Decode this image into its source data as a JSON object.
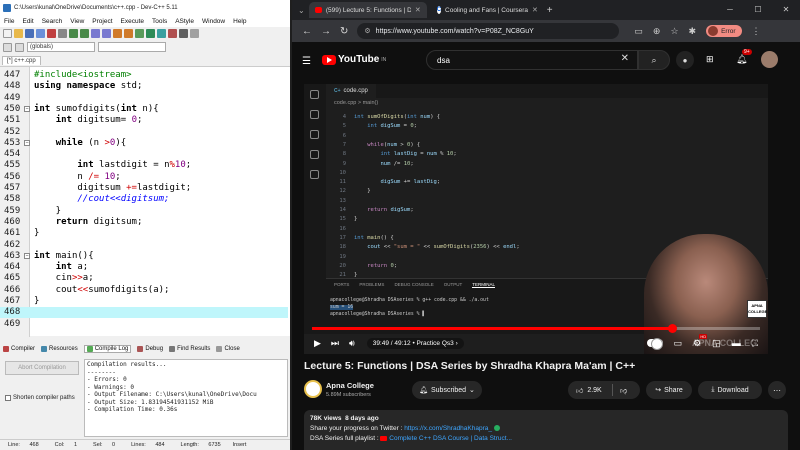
{
  "devcpp": {
    "window_title": "C:\\Users\\kunal\\OneDrive\\Documents\\c++.cpp - Dev-C++ 5.11",
    "menu": [
      "File",
      "Edit",
      "Search",
      "View",
      "Project",
      "Execute",
      "Tools",
      "AStyle",
      "Window",
      "Help"
    ],
    "scope_combo": "(globals)",
    "file_tab": "[*] c++.cpp",
    "code_lines": [
      {
        "n": "447",
        "text": "#include<iostream>"
      },
      {
        "n": "448",
        "text": "using namespace std;"
      },
      {
        "n": "449",
        "text": ""
      },
      {
        "n": "450",
        "text": "int sumofdigits(int n){"
      },
      {
        "n": "451",
        "text": "    int digitsum= 0;"
      },
      {
        "n": "452",
        "text": ""
      },
      {
        "n": "453",
        "text": "    while (n >0){"
      },
      {
        "n": "454",
        "text": ""
      },
      {
        "n": "455",
        "text": "        int lastdigit = n%10;"
      },
      {
        "n": "456",
        "text": "        n /= 10;"
      },
      {
        "n": "457",
        "text": "        digitsum +=lastdigit;"
      },
      {
        "n": "458",
        "text": "        //cout<<digitsum;"
      },
      {
        "n": "459",
        "text": "    }"
      },
      {
        "n": "460",
        "text": "    return digitsum;"
      },
      {
        "n": "461",
        "text": "}"
      },
      {
        "n": "462",
        "text": ""
      },
      {
        "n": "463",
        "text": "int main(){"
      },
      {
        "n": "464",
        "text": "    int a;"
      },
      {
        "n": "465",
        "text": "    cin>>a;"
      },
      {
        "n": "466",
        "text": "    cout<<sumofdigits(a);"
      },
      {
        "n": "467",
        "text": "}"
      },
      {
        "n": "468",
        "text": ""
      },
      {
        "n": "469",
        "text": ""
      }
    ],
    "bottom_tabs": [
      "Compiler",
      "Resources",
      "Compile Log",
      "Debug",
      "Find Results",
      "Close"
    ],
    "abort_label": "Abort Compilation",
    "shorten_label": "Shorten compiler paths",
    "log_lines": [
      "Compilation results...",
      "--------",
      "- Errors: 0",
      "- Warnings: 0",
      "- Output Filename: C:\\Users\\kunal\\OneDrive\\Docu",
      "- Output Size: 1.83194541931152 MiB",
      "- Compilation Time: 0.36s"
    ],
    "status": {
      "line_label": "Line:",
      "line": "468",
      "col_label": "Col:",
      "col": "1",
      "sel_label": "Sel:",
      "sel": "0",
      "lines_label": "Lines:",
      "lines": "484",
      "length_label": "Length:",
      "length": "6735",
      "mode": "Insert"
    }
  },
  "browser": {
    "tab_active": "(599) Lecture 5: Functions | DSA",
    "tab_inactive": "Cooling and Fans | Coursera",
    "url": "https://www.youtube.com/watch?v=P08Z_NC8GuY",
    "error_label": "Error"
  },
  "youtube": {
    "logo_text": "YouTube",
    "logo_region": "IN",
    "search_value": "dsa",
    "notif_count": "9+",
    "video": {
      "file_tab": "code.cpp",
      "breadcrumb": "code.cpp > main()",
      "code": [
        {
          "n": "4",
          "text": "int sumOfDigits(int num) {"
        },
        {
          "n": "5",
          "text": "    int digSum = 0;"
        },
        {
          "n": "6",
          "text": ""
        },
        {
          "n": "7",
          "text": "    while(num > 0) {"
        },
        {
          "n": "8",
          "text": "        int lastDig = num % 10;"
        },
        {
          "n": "9",
          "text": "        num /= 10;"
        },
        {
          "n": "10",
          "text": ""
        },
        {
          "n": "11",
          "text": "        digSum += lastDig;"
        },
        {
          "n": "12",
          "text": "    }"
        },
        {
          "n": "13",
          "text": ""
        },
        {
          "n": "14",
          "text": "    return digSum;"
        },
        {
          "n": "15",
          "text": "}"
        },
        {
          "n": "16",
          "text": ""
        },
        {
          "n": "17",
          "text": "int main() {"
        },
        {
          "n": "18",
          "text": "    cout << \"sum = \" << sumOfDigits(2356) << endl;"
        },
        {
          "n": "19",
          "text": ""
        },
        {
          "n": "20",
          "text": "    return 0;"
        },
        {
          "n": "21",
          "text": "}"
        }
      ],
      "panel_tabs": [
        "PORTS",
        "PROBLEMS",
        "DEBUG CONSOLE",
        "OUTPUT",
        "TERMINAL"
      ],
      "terminal": [
        "apnacollege@Shradha DSAseries % g++ code.cpp && ./a.out",
        "sum = 16",
        "apnacollege@Shradha DSAseries % "
      ],
      "badge_text": "APNA COLLEGE",
      "watermark": "APNA COLLEG"
    },
    "player": {
      "progress": 0.8043,
      "time": "39:49 / 49:12",
      "chapter": "Practice Qs3"
    },
    "title": "Lecture 5: Functions | DSA Series by Shradha Khapra Ma'am | C++",
    "channel": {
      "name": "Apna College",
      "subscribers": "5.89M subscribers",
      "subscribe_label": "Subscribed"
    },
    "actions": {
      "likes": "2.9K",
      "share": "Share",
      "download": "Download"
    },
    "description": {
      "views": "78K views",
      "date": "8 days ago",
      "line1_prefix": "Share your progress on Twitter : ",
      "line1_link": "https://x.com/ShradhaKhapra_",
      "line2_prefix": "DSA Series full playlist : ",
      "line2_link": "Complete C++ DSA Course | Data Struct..."
    }
  }
}
